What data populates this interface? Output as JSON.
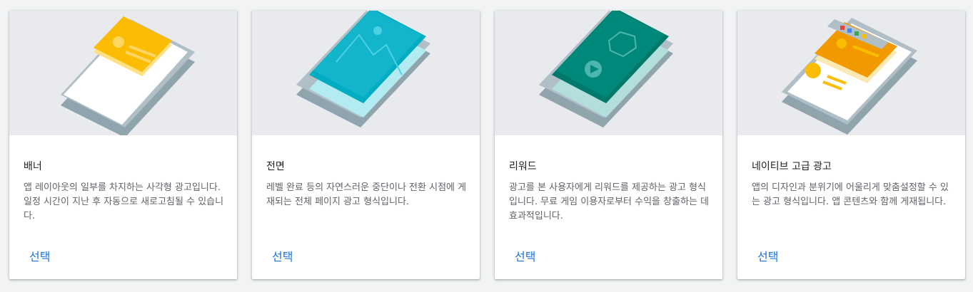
{
  "cards": [
    {
      "title": "배너",
      "description": "앱 레이아웃의 일부를 차지하는 사각형 광고입니다. 일정 시간이 지난 후 자동으로 새로고침될 수 있습니다.",
      "button": "선택",
      "illustration": "banner-illustration"
    },
    {
      "title": "전면",
      "description": "레벨 완료 등의 자연스러운 중단이나 전환 시점에 게재되는 전체 페이지 광고 형식입니다.",
      "button": "선택",
      "illustration": "interstitial-illustration"
    },
    {
      "title": "리워드",
      "description": "광고를 본 사용자에게 리워드를 제공하는 광고 형식입니다. 무료 게임 이용자로부터 수익을 창출하는 데 효과적입니다.",
      "button": "선택",
      "illustration": "rewarded-illustration"
    },
    {
      "title": "네이티브 고급 광고",
      "description": "앱의 디자인과 분위기에 어울리게 맞춤설정할 수 있는 광고 형식입니다. 앱 콘텐츠와 함께 게재됩니다.",
      "button": "선택",
      "illustration": "native-illustration"
    }
  ],
  "colors": {
    "accent": "#1a73e8",
    "banner_orange": "#fbbc04",
    "interstitial_teal": "#12b5cb",
    "rewarded_green": "#00897b",
    "native_orange": "#f29900"
  }
}
